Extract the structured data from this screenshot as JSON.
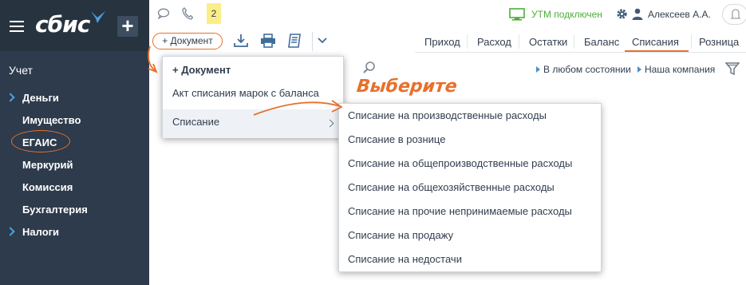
{
  "app": {
    "logo_text": "сбис",
    "badge_count": "2",
    "utm_status": "УТМ подключен",
    "user_name": "Алексеев А.А."
  },
  "sidebar": {
    "section_title": "Учет",
    "items": [
      {
        "label": "Деньги",
        "expandable": true
      },
      {
        "label": "Имущество",
        "expandable": false
      },
      {
        "label": "ЕГАИС",
        "expandable": false,
        "highlighted": true
      },
      {
        "label": "Меркурий",
        "expandable": false
      },
      {
        "label": "Комиссия",
        "expandable": false
      },
      {
        "label": "Бухгалтерия",
        "expandable": false
      },
      {
        "label": "Налоги",
        "expandable": true
      }
    ]
  },
  "toolbar": {
    "add_document_label": "+ Документ"
  },
  "tabs": [
    {
      "label": "Приход",
      "active": false
    },
    {
      "label": "Расход",
      "active": false
    },
    {
      "label": "Остатки",
      "active": false
    },
    {
      "label": "Баланс",
      "active": false
    },
    {
      "label": "Списания",
      "active": true
    },
    {
      "label": "Розница",
      "active": false
    }
  ],
  "filters": {
    "state": "В любом состоянии",
    "company": "Наша компания"
  },
  "menu": {
    "items": [
      {
        "label": "+ Документ",
        "bold": true
      },
      {
        "label": "Акт списания марок с баланса",
        "bold": false
      },
      {
        "label": "Списание",
        "bold": false,
        "has_submenu": true
      }
    ]
  },
  "submenu": {
    "items": [
      "Списание на производственные расходы",
      "Списание в рознице",
      "Списание на общепроизводственные расходы",
      "Списание на общехозяйственные расходы",
      "Списание на прочие непринимаемые расходы",
      "Списание на продажу",
      "Списание на недостачи"
    ]
  },
  "annotation": {
    "hint_text": "Выберите"
  },
  "colors": {
    "accent": "#e8702b",
    "sidebar_bg": "#2d3b4c",
    "status_green": "#4dae3a",
    "link_blue": "#4a90c8"
  }
}
